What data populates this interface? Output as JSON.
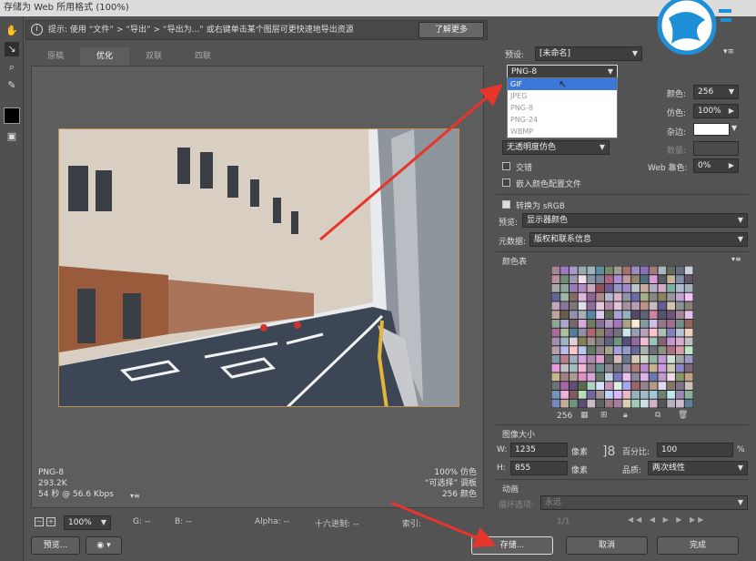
{
  "window": {
    "title": "存储为 Web 所用格式 (100%)"
  },
  "infobar": {
    "hint": "提示: 使用 “文件” > “导出” > “导出为...” 或右键单击某个图层可更快速地导出资源",
    "learn_more": "了解更多"
  },
  "tabs": [
    {
      "label": "原稿"
    },
    {
      "label": "优化"
    },
    {
      "label": "双联"
    },
    {
      "label": "四联"
    }
  ],
  "preview_status": {
    "format": "PNG-8",
    "size": "293.2K",
    "time": "54 秒 @ 56.6 Kbps",
    "dither": "100% 仿色",
    "palette": "“可选择” 调板",
    "colors": "256 颜色"
  },
  "bottombar": {
    "zoom": "100%",
    "g": "G: --",
    "b": "B: --",
    "alpha": "Alpha: --",
    "hex": "十六进制: --",
    "index": "索引:"
  },
  "buttons": {
    "preview": "预览...",
    "save": "存储...",
    "cancel": "取消",
    "done": "完成"
  },
  "settings": {
    "preset_label": "预设:",
    "preset_value": "[未命名]",
    "format_value": "PNG-8",
    "format_options": [
      "GIF",
      "JPEG",
      "PNG-8",
      "PNG-24",
      "WBMP"
    ],
    "colors_label": "颜色:",
    "colors_value": "256",
    "dither_label": "仿色:",
    "dither_value": "100%",
    "matte_label": "杂边:",
    "amount_label": "数量:",
    "transparency_dither": "无透明度仿色",
    "interlaced": "交错",
    "web_snap_label": "Web 靠色:",
    "web_snap_value": "0%",
    "embed_profile": "嵌入颜色配置文件",
    "convert_srgb": "转换为 sRGB",
    "preview_label": "预览:",
    "preview_value": "显示器颜色",
    "metadata_label": "元数据:",
    "metadata_value": "版权和联系信息"
  },
  "color_table": {
    "title": "颜色表",
    "count": "256"
  },
  "image_size": {
    "title": "图像大小",
    "w_label": "W:",
    "w_value": "1235",
    "h_label": "H:",
    "h_value": "855",
    "unit": "像素",
    "percent_label": "百分比:",
    "percent_value": "100",
    "percent_unit": "%",
    "quality_label": "品质:",
    "quality_value": "两次线性"
  },
  "animation": {
    "title": "动画",
    "loop_label": "循环选项:",
    "loop_value": "永远",
    "frame": "1/1"
  },
  "colors": {
    "arrow": "#e8352c",
    "accent": "#3c78d8"
  }
}
